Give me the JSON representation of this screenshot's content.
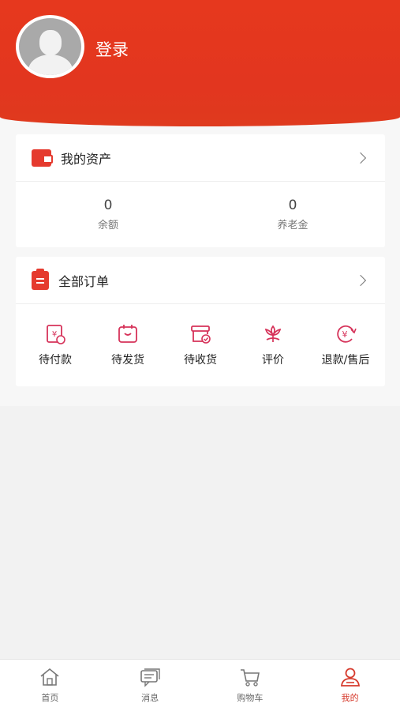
{
  "header": {
    "login_label": "登录"
  },
  "assets": {
    "title": "我的资产",
    "balance": {
      "value": "0",
      "label": "余额"
    },
    "pension": {
      "value": "0",
      "label": "养老金"
    }
  },
  "orders": {
    "title": "全部订单",
    "items": [
      {
        "label": "待付款",
        "icon": "pending-payment-icon"
      },
      {
        "label": "待发货",
        "icon": "pending-shipment-icon"
      },
      {
        "label": "待收货",
        "icon": "pending-receipt-icon"
      },
      {
        "label": "评价",
        "icon": "review-icon"
      },
      {
        "label": "退款/售后",
        "icon": "refund-icon"
      }
    ]
  },
  "tabbar": {
    "items": [
      {
        "label": "首页",
        "icon": "home-icon"
      },
      {
        "label": "消息",
        "icon": "message-icon"
      },
      {
        "label": "购物车",
        "icon": "cart-icon"
      },
      {
        "label": "我的",
        "icon": "profile-icon",
        "active": true
      }
    ]
  },
  "colors": {
    "brand": "#e2361f",
    "accent_icon": "#d6335a",
    "active_tab": "#d63a2c"
  }
}
